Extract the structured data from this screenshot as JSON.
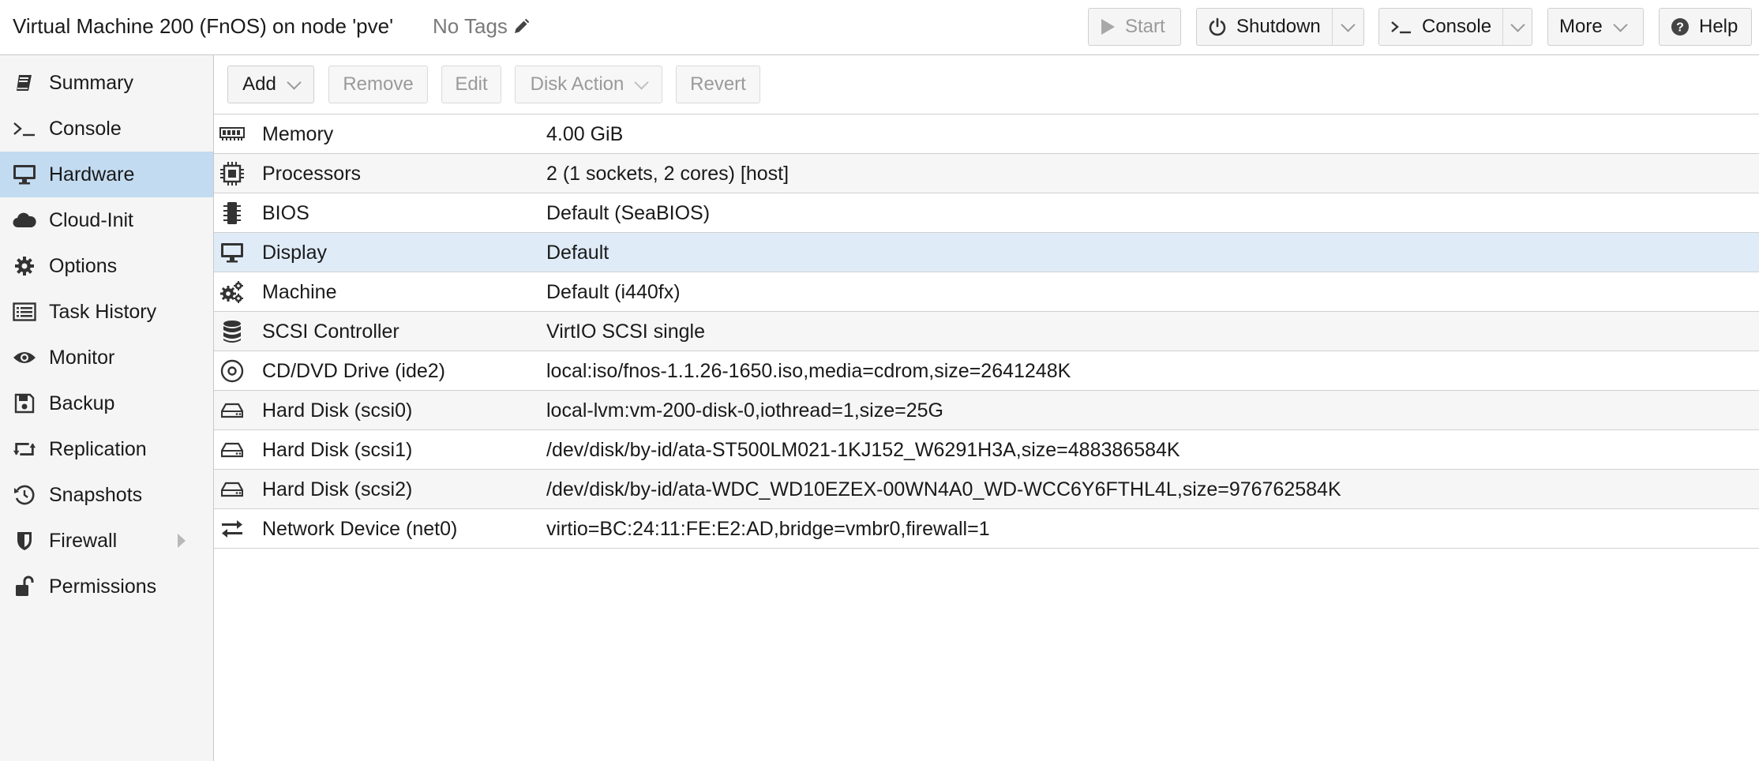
{
  "header": {
    "title": "Virtual Machine 200 (FnOS) on node 'pve'",
    "tags_label": "No Tags",
    "buttons": {
      "start": "Start",
      "shutdown": "Shutdown",
      "console": "Console",
      "more": "More",
      "help": "Help"
    }
  },
  "sidebar": {
    "items": [
      {
        "label": "Summary",
        "icon": "book-icon"
      },
      {
        "label": "Console",
        "icon": "terminal-icon"
      },
      {
        "label": "Hardware",
        "icon": "desktop-icon",
        "active": true
      },
      {
        "label": "Cloud-Init",
        "icon": "cloud-icon"
      },
      {
        "label": "Options",
        "icon": "gear-icon"
      },
      {
        "label": "Task History",
        "icon": "list-icon"
      },
      {
        "label": "Monitor",
        "icon": "eye-icon"
      },
      {
        "label": "Backup",
        "icon": "floppy-icon"
      },
      {
        "label": "Replication",
        "icon": "retweet-icon"
      },
      {
        "label": "Snapshots",
        "icon": "history-icon"
      },
      {
        "label": "Firewall",
        "icon": "shield-icon",
        "has_submenu": true
      },
      {
        "label": "Permissions",
        "icon": "unlock-icon"
      }
    ]
  },
  "toolbar": {
    "add": "Add",
    "remove": "Remove",
    "edit": "Edit",
    "disk_action": "Disk Action",
    "revert": "Revert"
  },
  "hardware": {
    "rows": [
      {
        "name": "Memory",
        "value": "4.00 GiB",
        "icon": "memory-icon"
      },
      {
        "name": "Processors",
        "value": "2 (1 sockets, 2 cores) [host]",
        "icon": "cpu-icon"
      },
      {
        "name": "BIOS",
        "value": "Default (SeaBIOS)",
        "icon": "microchip-icon"
      },
      {
        "name": "Display",
        "value": "Default",
        "icon": "desktop-icon",
        "selected": true
      },
      {
        "name": "Machine",
        "value": "Default (i440fx)",
        "icon": "cogs-icon"
      },
      {
        "name": "SCSI Controller",
        "value": "VirtIO SCSI single",
        "icon": "database-icon"
      },
      {
        "name": "CD/DVD Drive (ide2)",
        "value": "local:iso/fnos-1.1.26-1650.iso,media=cdrom,size=2641248K",
        "icon": "cdrom-icon"
      },
      {
        "name": "Hard Disk (scsi0)",
        "value": "local-lvm:vm-200-disk-0,iothread=1,size=25G",
        "icon": "hdd-icon"
      },
      {
        "name": "Hard Disk (scsi1)",
        "value": "/dev/disk/by-id/ata-ST500LM021-1KJ152_W6291H3A,size=488386584K",
        "icon": "hdd-icon"
      },
      {
        "name": "Hard Disk (scsi2)",
        "value": "/dev/disk/by-id/ata-WDC_WD10EZEX-00WN4A0_WD-WCC6Y6FTHL4L,size=976762584K",
        "icon": "hdd-icon"
      },
      {
        "name": "Network Device (net0)",
        "value": "virtio=BC:24:11:FE:E2:AD,bridge=vmbr0,firewall=1",
        "icon": "exchange-icon"
      }
    ]
  }
}
